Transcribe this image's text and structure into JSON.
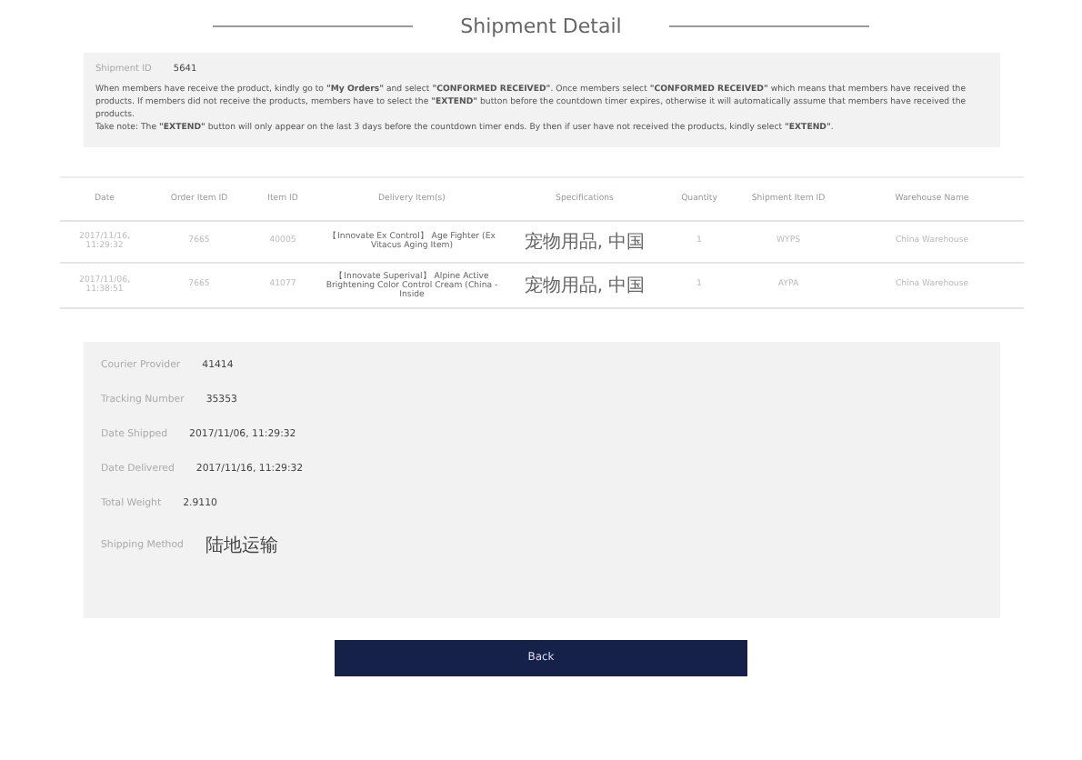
{
  "title": "Shipment Detail",
  "shipment": {
    "label": "Shipment ID",
    "value": "5641"
  },
  "notes": [
    "When members have receive the product, kindly go to **\"My Orders\"** and select **\"CONFORMED RECEIVED\"**. Once members select **\"CONFORMED RECEIVED\"** which means that members have received the products. If members did not receive the products, members have to select the **\"EXTEND\"** button before the countdown timer expires, otherwise it will automatically assume that members have received the products.",
    "Take note: The **\"EXTEND\"** button will only appear on the last 3 days before the countdown timer ends. By then if user have not received the products, kindly select **\"EXTEND\"**."
  ],
  "table": {
    "columns": [
      "Date",
      "Order Item ID",
      "Item ID",
      "Delivery Item(s)",
      "Specifications",
      "Quantity",
      "Shipment Item ID",
      "Warehouse Name"
    ],
    "rows": [
      [
        "2017/11/16, 11:29:32",
        "7665",
        "40005",
        "【Innovate Ex Control】 Age Fighter (Ex Vitacus Aging Item)",
        "宠物用品, 中国",
        "1",
        "WYPS",
        "China Warehouse"
      ],
      [
        "2017/11/06, 11:38:51",
        "7665",
        "41077",
        "【Innovate Superival】 Alpine Active Brightening Color Control Cream (China - Inside",
        "宠物用品, 中国",
        "1",
        "AYPA",
        "China Warehouse"
      ]
    ]
  },
  "details": [
    {
      "label": "Courier Provider",
      "value": "41414"
    },
    {
      "label": "Tracking Number",
      "value": "35353"
    },
    {
      "label": "Date Shipped",
      "value": "2017/11/06, 11:29:32"
    },
    {
      "label": "Date Delivered",
      "value": "2017/11/16, 11:29:32"
    },
    {
      "label": "Total Weight",
      "value": "2.9110"
    },
    {
      "label": "Shipping Method",
      "value": "陆地运输"
    }
  ],
  "button": "Back"
}
